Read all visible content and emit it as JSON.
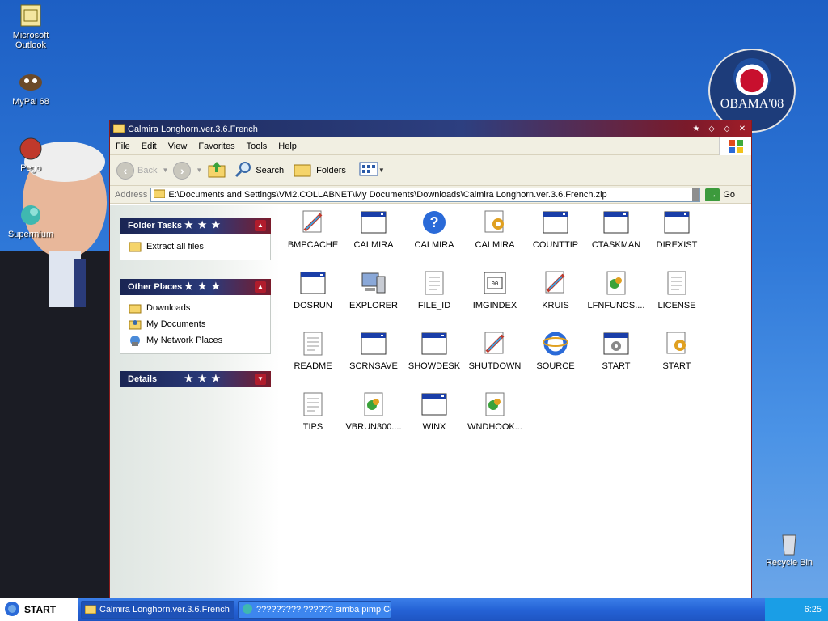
{
  "desktop": {
    "icons": [
      {
        "label_line1": "Microsoft",
        "label_line2": "Outlook",
        "icon": "outlook-icon"
      },
      {
        "label_line1": "MyPal 68",
        "label_line2": "",
        "icon": "mypal-icon"
      },
      {
        "label_line1": "Pego",
        "label_line2": "",
        "icon": "pego-icon"
      },
      {
        "label_line1": "Supermium",
        "label_line2": "",
        "icon": "supermium-icon"
      },
      {
        "label_line1": "Recycle Bin",
        "label_line2": "",
        "icon": "recycle-bin-icon"
      }
    ],
    "logo_text": "OBAMA'08"
  },
  "window": {
    "title": "Calmira Longhorn.ver.3.6.French",
    "menu": [
      "File",
      "Edit",
      "View",
      "Favorites",
      "Tools",
      "Help"
    ],
    "toolbar": {
      "back": "Back",
      "search": "Search",
      "folders": "Folders"
    },
    "address": {
      "label": "Address",
      "value": "E:\\Documents and Settings\\VM2.COLLABNET\\My Documents\\Downloads\\Calmira Longhorn.ver.3.6.French.zip",
      "go": "Go"
    },
    "panels": {
      "folder_tasks": {
        "title": "Folder Tasks",
        "items": [
          "Extract all files"
        ]
      },
      "other_places": {
        "title": "Other Places",
        "items": [
          "Downloads",
          "My Documents",
          "My Network Places"
        ]
      },
      "details": {
        "title": "Details"
      }
    },
    "files": [
      {
        "name": "BMPCACHE",
        "icon": "paint-icon"
      },
      {
        "name": "CALMIRA",
        "icon": "app-window-icon"
      },
      {
        "name": "CALMIRA",
        "icon": "help-icon"
      },
      {
        "name": "CALMIRA",
        "icon": "settings-file-icon"
      },
      {
        "name": "COUNTTIP",
        "icon": "app-window-icon"
      },
      {
        "name": "CTASKMAN",
        "icon": "app-window-icon"
      },
      {
        "name": "DIREXIST",
        "icon": "app-window-icon"
      },
      {
        "name": "DOSRUN",
        "icon": "app-window-icon"
      },
      {
        "name": "EXPLORER",
        "icon": "computer-icon"
      },
      {
        "name": "FILE_ID",
        "icon": "text-file-icon"
      },
      {
        "name": "IMGINDEX",
        "icon": "image-index-icon"
      },
      {
        "name": "KRUIS",
        "icon": "paint-icon"
      },
      {
        "name": "LFNFUNCS....",
        "icon": "dll-icon"
      },
      {
        "name": "LICENSE",
        "icon": "text-file-icon"
      },
      {
        "name": "README",
        "icon": "text-file-icon"
      },
      {
        "name": "SCRNSAVE",
        "icon": "app-window-icon"
      },
      {
        "name": "SHOWDESK",
        "icon": "app-window-icon"
      },
      {
        "name": "SHUTDOWN",
        "icon": "paint-icon"
      },
      {
        "name": "SOURCE",
        "icon": "ie-icon"
      },
      {
        "name": "START",
        "icon": "gear-window-icon"
      },
      {
        "name": "START",
        "icon": "settings-file-icon"
      },
      {
        "name": "TIPS",
        "icon": "text-file-icon"
      },
      {
        "name": "VBRUN300....",
        "icon": "dll-icon"
      },
      {
        "name": "WINX",
        "icon": "app-window-icon"
      },
      {
        "name": "WNDHOOK...",
        "icon": "dll-icon"
      }
    ]
  },
  "taskbar": {
    "start_label": "START",
    "tasks": [
      {
        "label": "Calmira Longhorn.ver.3.6.French",
        "active": true
      },
      {
        "label": "????????? ?????? simba pimp Con...",
        "active": false
      }
    ],
    "clock": "6:25"
  },
  "colors": {
    "title_navy": "#1c2a5c",
    "title_red": "#a01c28",
    "taskbar_blue": "#2563d6"
  }
}
